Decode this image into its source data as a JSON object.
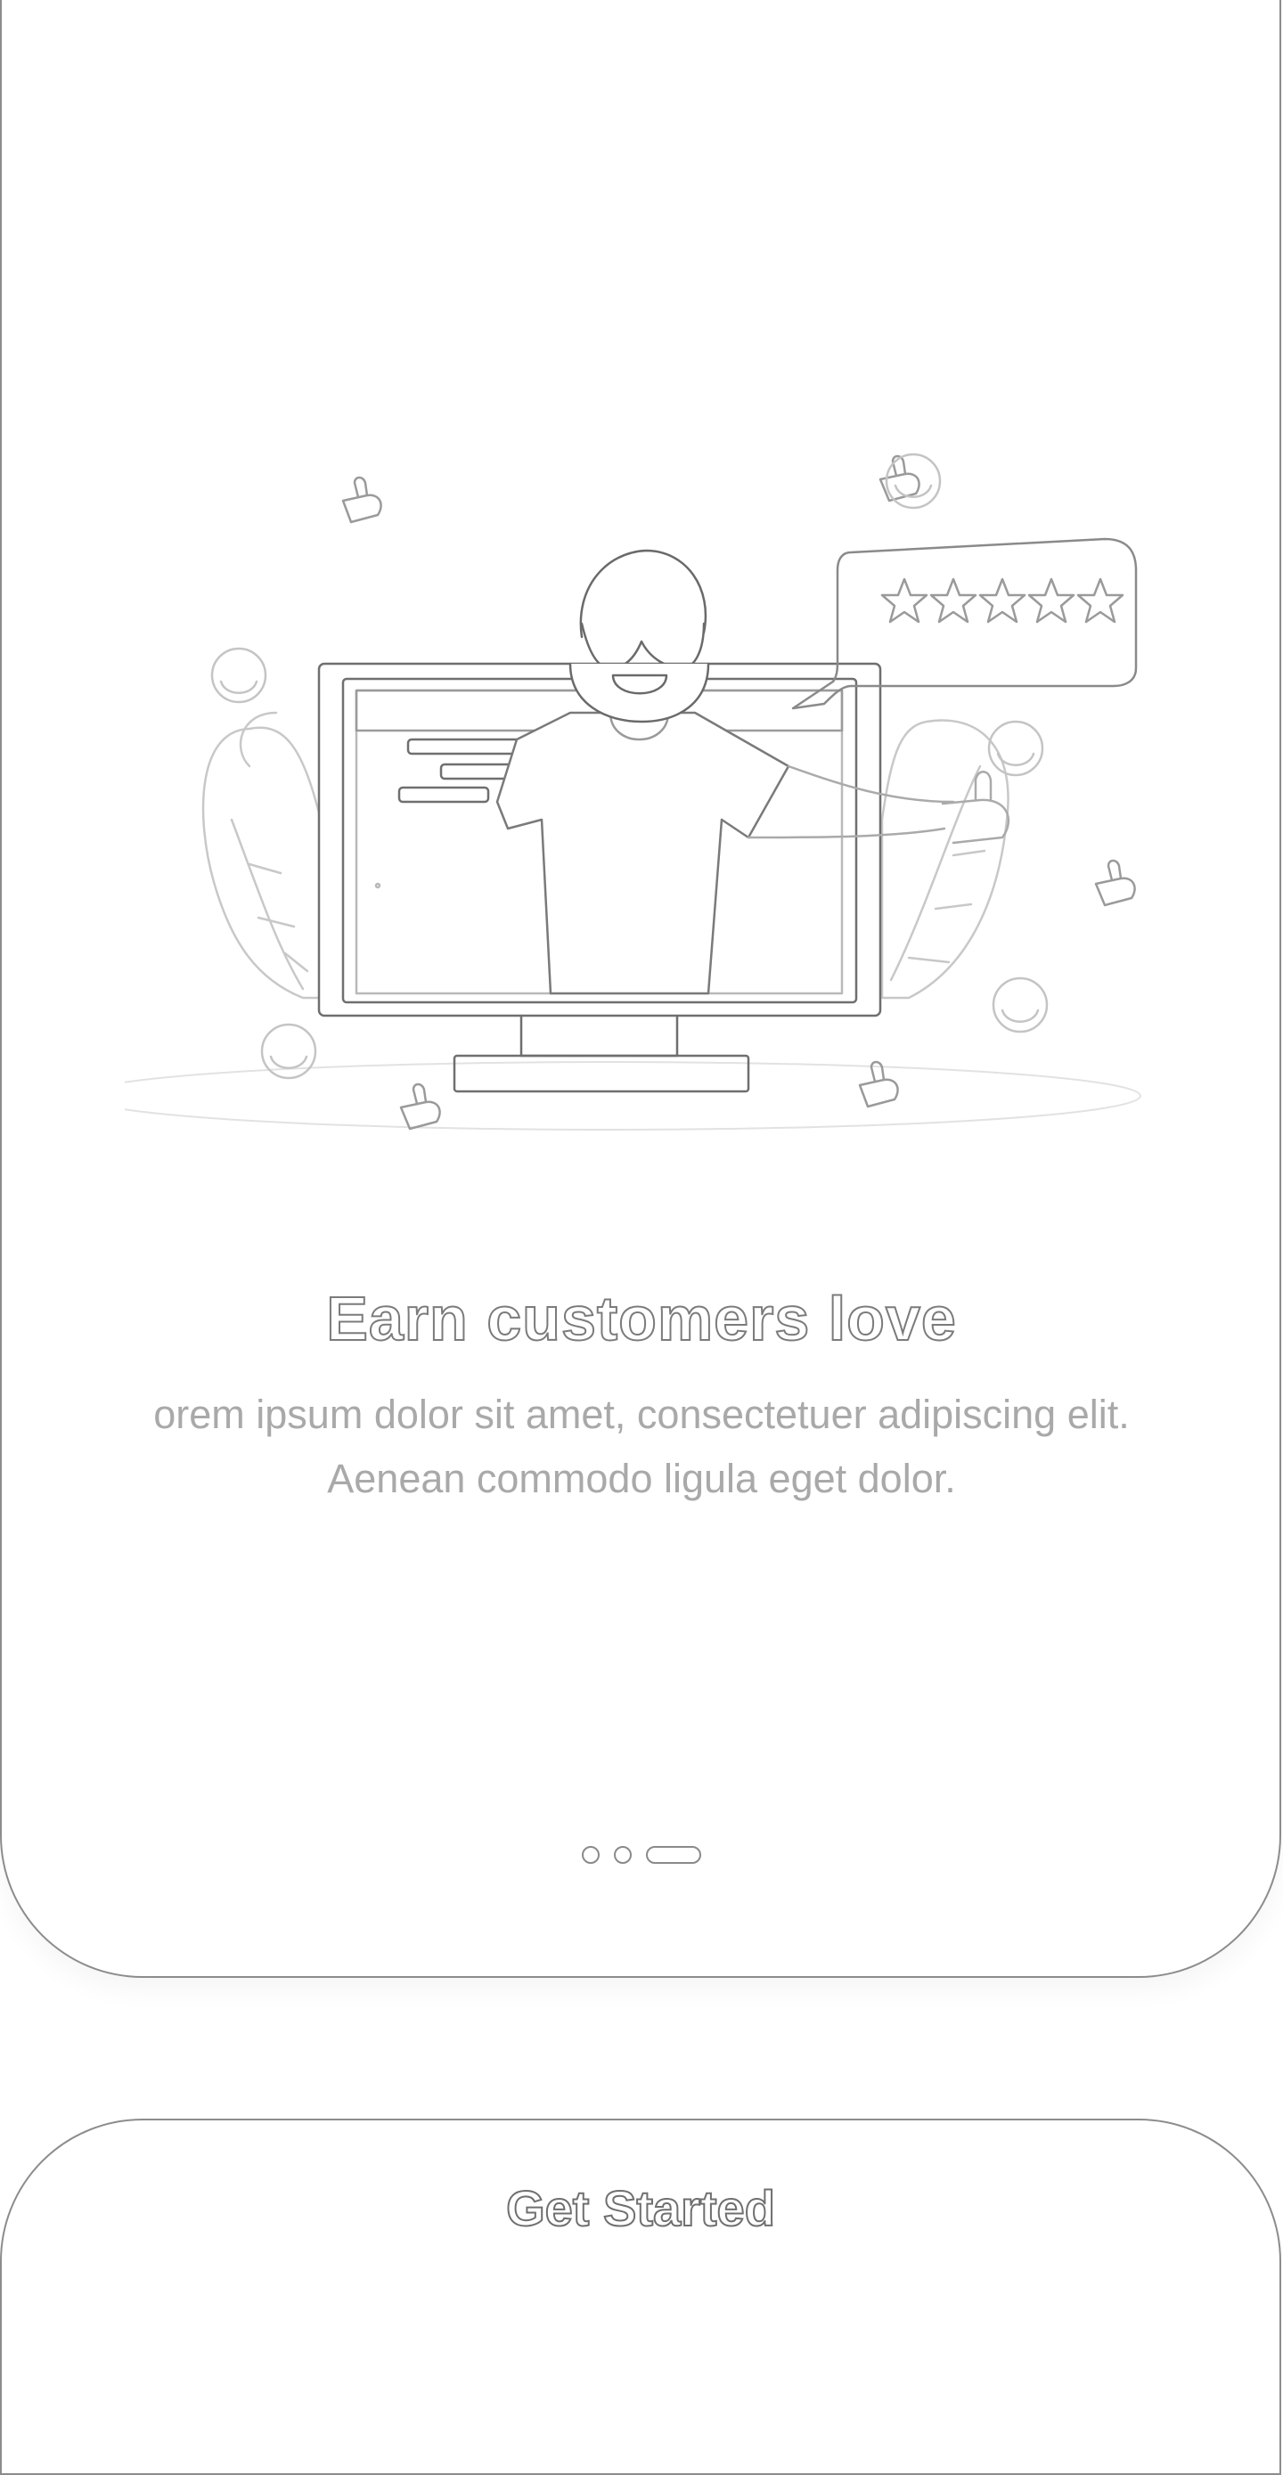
{
  "onboarding": {
    "title": "Earn customers love",
    "description": "orem ipsum dolor sit amet, consectetuer adipiscing elit. Aenean commodo ligula eget dolor.",
    "pagination": {
      "total": 3,
      "active_index": 2
    }
  },
  "cta": {
    "label": "Get Started"
  },
  "illustration": {
    "icons": [
      "thumbs-up-icon",
      "smiley-icon",
      "star-icon",
      "monitor-icon",
      "person-icon",
      "plant-icon",
      "speech-bubble-icon"
    ],
    "rating_stars": 5
  }
}
